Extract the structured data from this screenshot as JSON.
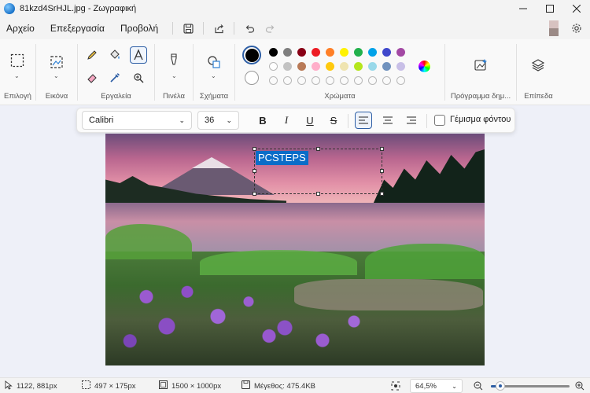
{
  "window": {
    "title": "81kzd4SrHJL.jpg - Ζωγραφική",
    "app_icon": "paint-globe-icon",
    "controls": [
      "minimize-icon",
      "maximize-icon",
      "close-icon"
    ]
  },
  "menu": {
    "items": [
      "Αρχείο",
      "Επεξεργασία",
      "Προβολή"
    ],
    "quick_actions": [
      "save-icon",
      "share-icon",
      "undo-icon",
      "redo-icon"
    ],
    "right": [
      "color-swatch-icon",
      "settings-gear-icon"
    ]
  },
  "ribbon": {
    "groups": {
      "selection": "Επιλογή",
      "image": "Εικόνα",
      "tools": "Εργαλεία",
      "brushes": "Πινέλα",
      "shapes": "Σχήματα",
      "colors": "Χρώματα",
      "creator": "Πρόγραμμα δημ...",
      "layers": "Επίπεδα"
    },
    "tools": [
      "pencil-icon",
      "fill-bucket-icon",
      "text-icon",
      "eraser-icon",
      "color-picker-icon",
      "magnifier-icon"
    ],
    "active_tool": "text-icon",
    "current_colors": {
      "primary": "#000000",
      "secondary": "#ffffff"
    },
    "palette_row1": [
      "#000000",
      "#7f7f7f",
      "#880015",
      "#ed1c24",
      "#ff7f27",
      "#fff200",
      "#22b14c",
      "#00a2e8",
      "#3f48cc",
      "#a349a4"
    ],
    "palette_row2": [
      "#ffffff",
      "#c3c3c3",
      "#b97a57",
      "#ffaec9",
      "#ffc90e",
      "#efe4b0",
      "#b5e61d",
      "#99d9ea",
      "#7092be",
      "#c8bfe7"
    ],
    "palette_row3_empty": 10
  },
  "textbar": {
    "font_family": "Calibri",
    "font_size": "36",
    "bold": "B",
    "italic": "I",
    "underline": "U",
    "strikethrough": "S",
    "align_selected": "align-left",
    "fill_background_label": "Γέμισμα φόντου"
  },
  "canvas": {
    "typed_text": "PCSTEPS"
  },
  "status": {
    "cursor_pos": "1122, 881px",
    "selection_size": "497 × 175px",
    "canvas_size": "1500 × 1000px",
    "file_size": "Μέγεθος: 475.4KB",
    "zoom": "64,5%",
    "zoom_level": 0.12
  }
}
